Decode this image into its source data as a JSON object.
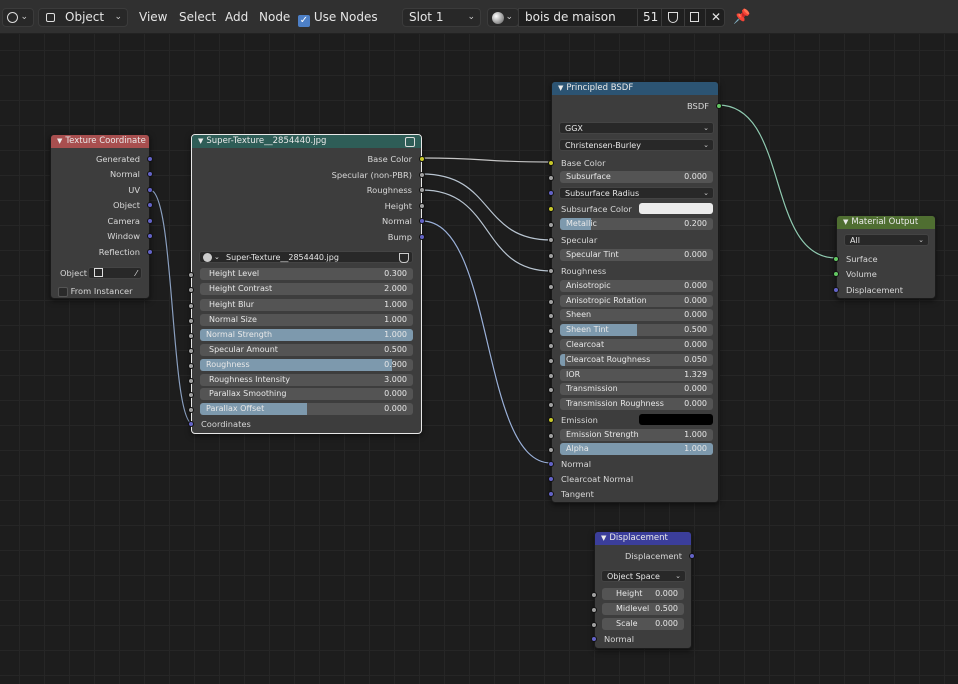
{
  "header": {
    "editor_type_icon": "node-editor-icon",
    "mode": "Object",
    "menus": [
      "View",
      "Select",
      "Add",
      "Node"
    ],
    "use_nodes_label": "Use Nodes",
    "use_nodes_checked": true,
    "slot": "Slot 1",
    "material_name": "bois de maison",
    "user_count": "51",
    "pin_icon": "pin-icon"
  },
  "texture_coordinate": {
    "title": "Texture Coordinate",
    "outputs": [
      "Generated",
      "Normal",
      "UV",
      "Object",
      "Camera",
      "Window",
      "Reflection"
    ],
    "object_label": "Object:",
    "from_instancer": "From Instancer"
  },
  "super_texture": {
    "title": "Super-Texture__2854440.jpg",
    "outputs": [
      "Base Color",
      "Specular (non-PBR)",
      "Roughness",
      "Height",
      "Normal",
      "Bump"
    ],
    "image_name": "Super-Texture__2854440.jpg",
    "params": [
      {
        "label": "Height Level",
        "value": "0.300",
        "fill": 0
      },
      {
        "label": "Height Contrast",
        "value": "2.000",
        "fill": 0
      },
      {
        "label": "Height Blur",
        "value": "1.000",
        "fill": 0
      },
      {
        "label": "Normal Size",
        "value": "1.000",
        "fill": 0
      },
      {
        "label": "Normal Strength",
        "value": "1.000",
        "fill": 1
      },
      {
        "label": "Specular Amount",
        "value": "0.500",
        "fill": 0
      },
      {
        "label": "Roughness",
        "value": "0.900",
        "fill": 0.9
      },
      {
        "label": "Roughness Intensity",
        "value": "3.000",
        "fill": 0
      },
      {
        "label": "Parallax Smoothing",
        "value": "0.000",
        "fill": 0
      },
      {
        "label": "Parallax Offset",
        "value": "0.000",
        "fill": 0.5
      }
    ],
    "coordinates_label": "Coordinates"
  },
  "principled": {
    "title": "Principled BSDF",
    "output": "BSDF",
    "distribution": "GGX",
    "subsurface_method": "Christensen-Burley",
    "base_color_label": "Base Color",
    "subsurface": {
      "label": "Subsurface",
      "value": "0.000"
    },
    "subsurface_radius": "Subsurface Radius",
    "subsurface_color": "Subsurface Color",
    "metallic": {
      "label": "Metallic",
      "value": "0.200",
      "fill": 0.2
    },
    "specular_label": "Specular",
    "specular_tint": {
      "label": "Specular Tint",
      "value": "0.000"
    },
    "roughness_label": "Roughness",
    "params": [
      {
        "label": "Anisotropic",
        "value": "0.000",
        "fill": 0
      },
      {
        "label": "Anisotropic Rotation",
        "value": "0.000",
        "fill": 0
      },
      {
        "label": "Sheen",
        "value": "0.000",
        "fill": 0
      },
      {
        "label": "Sheen Tint",
        "value": "0.500",
        "fill": 0.5
      },
      {
        "label": "Clearcoat",
        "value": "0.000",
        "fill": 0
      },
      {
        "label": "Clearcoat Roughness",
        "value": "0.050",
        "fill": 0.03
      },
      {
        "label": "IOR",
        "value": "1.329",
        "fill": 0
      },
      {
        "label": "Transmission",
        "value": "0.000",
        "fill": 0
      },
      {
        "label": "Transmission Roughness",
        "value": "0.000",
        "fill": 0
      }
    ],
    "emission_label": "Emission",
    "emission_strength": {
      "label": "Emission Strength",
      "value": "1.000"
    },
    "alpha": {
      "label": "Alpha",
      "value": "1.000",
      "fill": 1
    },
    "tail_inputs": [
      "Normal",
      "Clearcoat Normal",
      "Tangent"
    ],
    "subsurface_color_value": "#ececec",
    "emission_color_value": "#000000"
  },
  "material_output": {
    "title": "Material Output",
    "target": "All",
    "inputs": [
      "Surface",
      "Volume",
      "Displacement"
    ]
  },
  "displacement": {
    "title": "Displacement",
    "output": "Displacement",
    "space": "Object Space",
    "params": [
      {
        "label": "Height",
        "value": "0.000"
      },
      {
        "label": "Midlevel",
        "value": "0.500"
      },
      {
        "label": "Scale",
        "value": "0.000"
      }
    ],
    "normal_label": "Normal"
  },
  "colors": {
    "background": "#1d1d1d",
    "node_body": "#3d3d3d",
    "input_header": "#a84f4f",
    "texture_header": "#2e5d57",
    "shader_header": "#2c5473",
    "output_header": "#4f6e31",
    "vector_header": "#3b3e9b",
    "slider_fill": "#7d99ad"
  }
}
